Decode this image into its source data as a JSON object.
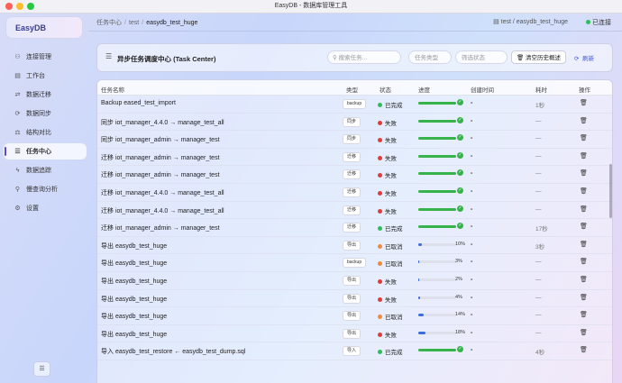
{
  "window": {
    "title": "EasyDB - 数据库管理工具"
  },
  "sidebar": {
    "brand": "EasyDB",
    "items": [
      {
        "label": "连接管理",
        "icon": "connection-icon",
        "glyph": "⚇"
      },
      {
        "label": "工作台",
        "icon": "workbench-icon",
        "glyph": "▤"
      },
      {
        "label": "数据迁移",
        "icon": "migration-icon",
        "glyph": "⇄"
      },
      {
        "label": "数据同步",
        "icon": "sync-icon",
        "glyph": "⟳"
      },
      {
        "label": "结构对比",
        "icon": "compare-icon",
        "glyph": "⚖"
      },
      {
        "label": "任务中心",
        "icon": "task-list-icon",
        "glyph": "☰",
        "active": true
      },
      {
        "label": "数据追踪",
        "icon": "trace-icon",
        "glyph": "ϟ"
      },
      {
        "label": "慢查询分析",
        "icon": "slow-query-icon",
        "glyph": "⚲"
      },
      {
        "label": "设置",
        "icon": "settings-icon",
        "glyph": "⚙"
      }
    ],
    "toggle_glyph": "☰"
  },
  "topbar": {
    "breadcrumb": [
      "任务中心",
      "test",
      "easydb_test_huge"
    ],
    "path": "test / easydb_test_huge",
    "status": "已连接"
  },
  "header": {
    "title": "异步任务调度中心 (Task Center)",
    "search_placeholder": "搜索任务...",
    "type_filter": "任务类型",
    "status_filter": "筛选状态",
    "clear_label": "清空历史概述",
    "refresh_label": "刷新"
  },
  "table": {
    "columns": [
      "任务名称",
      "类型",
      "状态",
      "进度",
      "创建时间",
      "耗时",
      "操作"
    ],
    "rows": [
      {
        "name": "Backup eased_test_import",
        "type": "backup",
        "status": "已完成",
        "status_color": "#2ebd5a",
        "progress": 1.0,
        "pct": "",
        "time": "-",
        "dur": "1秒"
      },
      {
        "name": "同步 iot_manager_4.4.0 → manage_test_all",
        "type": "同步",
        "status": "失败",
        "status_color": "#e23b3b",
        "progress": 1.0,
        "pct": "",
        "time": "-",
        "dur": "—"
      },
      {
        "name": "同步 iot_manager_admin → manager_test",
        "type": "同步",
        "status": "失败",
        "status_color": "#e23b3b",
        "progress": 1.0,
        "pct": "",
        "time": "-",
        "dur": "—"
      },
      {
        "name": "迁移 iot_manager_admin → manager_test",
        "type": "迁移",
        "status": "失败",
        "status_color": "#e23b3b",
        "progress": 1.0,
        "pct": "",
        "time": "-",
        "dur": "—"
      },
      {
        "name": "迁移 iot_manager_admin → manager_test",
        "type": "迁移",
        "status": "失败",
        "status_color": "#e23b3b",
        "progress": 1.0,
        "pct": "",
        "time": "-",
        "dur": "—"
      },
      {
        "name": "迁移 iot_manager_4.4.0 → manage_test_all",
        "type": "迁移",
        "status": "失败",
        "status_color": "#e23b3b",
        "progress": 1.0,
        "pct": "",
        "time": "-",
        "dur": "—"
      },
      {
        "name": "迁移 iot_manager_4.4.0 → manage_test_all",
        "type": "迁移",
        "status": "失败",
        "status_color": "#e23b3b",
        "progress": 1.0,
        "pct": "",
        "time": "-",
        "dur": "—"
      },
      {
        "name": "迁移 iot_manager_admin → manager_test",
        "type": "迁移",
        "status": "已完成",
        "status_color": "#2ebd5a",
        "progress": 1.0,
        "pct": "",
        "time": "-",
        "dur": "17秒"
      },
      {
        "name": "导出 easydb_test_huge",
        "type": "导出",
        "status": "已取消",
        "status_color": "#f08a3c",
        "progress": 0.1,
        "pct": "10%",
        "time": "-",
        "dur": "3秒"
      },
      {
        "name": "导出 easydb_test_huge",
        "type": "backup",
        "status": "已取消",
        "status_color": "#f08a3c",
        "progress": 0.03,
        "pct": "3%",
        "time": "-",
        "dur": "—"
      },
      {
        "name": "导出 easydb_test_huge",
        "type": "导出",
        "status": "失败",
        "status_color": "#e23b3b",
        "progress": 0.02,
        "pct": "2%",
        "time": "-",
        "dur": "—"
      },
      {
        "name": "导出 easydb_test_huge",
        "type": "导出",
        "status": "失败",
        "status_color": "#e23b3b",
        "progress": 0.04,
        "pct": "4%",
        "time": "-",
        "dur": "—"
      },
      {
        "name": "导出 easydb_test_huge",
        "type": "导出",
        "status": "已取消",
        "status_color": "#f08a3c",
        "progress": 0.14,
        "pct": "14%",
        "time": "-",
        "dur": "—"
      },
      {
        "name": "导出 easydb_test_huge",
        "type": "导出",
        "status": "失败",
        "status_color": "#e23b3b",
        "progress": 0.18,
        "pct": "18%",
        "time": "-",
        "dur": "—"
      },
      {
        "name": "导入 easydb_test_restore ← easydb_test_dump.sql",
        "type": "导入",
        "status": "已完成",
        "status_color": "#2ebd5a",
        "progress": 1.0,
        "pct": "",
        "time": "-",
        "dur": "4秒"
      }
    ]
  },
  "colors": {
    "accent": "#5b46d6",
    "success": "#36b34a",
    "partial": "#3a6ee0"
  }
}
